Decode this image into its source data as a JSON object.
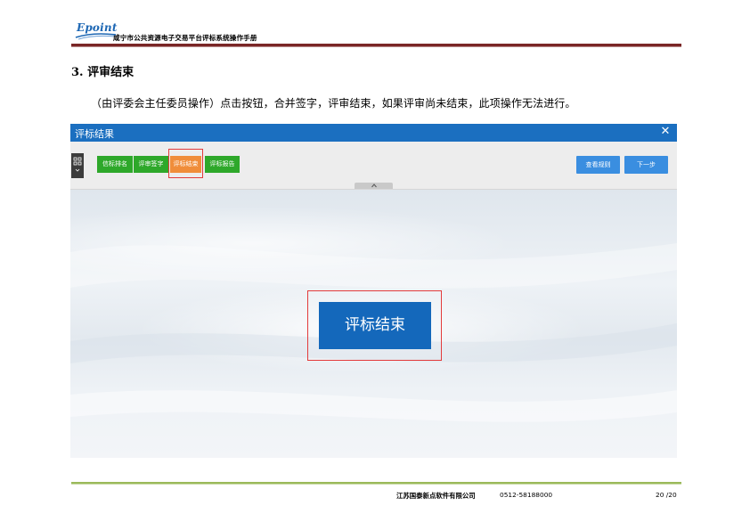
{
  "header": {
    "logo_text": "Epoint",
    "doc_title": "咸宁市公共资源电子交易平台评标系统操作手册"
  },
  "section": {
    "heading": "3. 评审结束",
    "body": "（由评委会主任委员操作）点击按钮，合并签字，评审结束，如果评审尚未结束，此项操作无法进行。"
  },
  "app": {
    "window_title": "评标结果",
    "close_icon": "close-icon",
    "steps": [
      {
        "label": "信标排名",
        "state": "done"
      },
      {
        "label": "评审签字",
        "state": "done"
      },
      {
        "label": "评标结束",
        "state": "active"
      },
      {
        "label": "评标报告",
        "state": "done"
      }
    ],
    "actions": {
      "view_rules": "查看规则",
      "next_step": "下一步"
    },
    "main_button": "评标结束",
    "colors": {
      "titlebar": "#1b6fc0",
      "step_done": "#2ea82a",
      "step_active": "#f08d3a",
      "action_button": "#3a8ee0",
      "main_button": "#1468bb",
      "highlight": "#e33b3b"
    }
  },
  "footer": {
    "company": "江苏国泰新点软件有限公司",
    "phone": "0512-58188000",
    "page": "20 /20"
  }
}
